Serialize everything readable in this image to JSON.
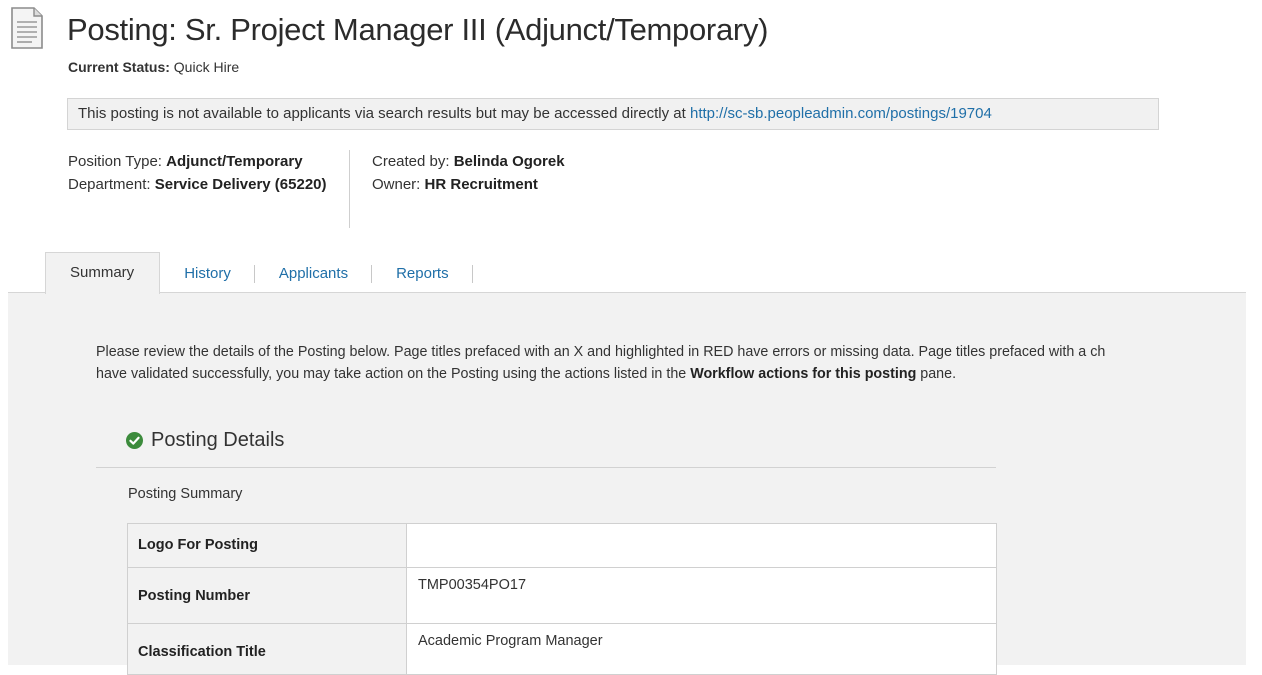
{
  "header": {
    "doc_icon": "document-icon",
    "title": "Posting: Sr. Project Manager III (Adjunct/Temporary)",
    "status_label": "Current Status:",
    "status_value": "Quick Hire"
  },
  "notice": {
    "text": "This posting is not available to applicants via search results but may be accessed directly at ",
    "link": "http://sc-sb.peopleadmin.com/postings/19704"
  },
  "meta": {
    "position_type_label": "Position Type:",
    "position_type_value": "Adjunct/Temporary",
    "department_label": "Department:",
    "department_value": "Service Delivery (65220)",
    "created_by_label": "Created by:",
    "created_by_value": "Belinda Ogorek",
    "owner_label": "Owner:",
    "owner_value": "HR Recruitment"
  },
  "tabs": [
    {
      "label": "Summary",
      "active": true
    },
    {
      "label": "History",
      "active": false
    },
    {
      "label": "Applicants",
      "active": false
    },
    {
      "label": "Reports",
      "active": false
    }
  ],
  "intro": {
    "line1": "Please review the details of the Posting below.  Page titles prefaced with an X and highlighted in RED have errors or missing data.  Page titles prefaced with a ch",
    "line2_before": "have validated successfully, you may take action on the Posting using the actions listed in the ",
    "line2_bold": "Workflow actions for this posting",
    "line2_after": " pane."
  },
  "section": {
    "check_icon": "check-circle-icon",
    "check_color": "#3c8b3c",
    "title": "Posting Details",
    "subtitle": "Posting Summary"
  },
  "summary_rows": [
    {
      "label": "Logo For Posting",
      "value": ""
    },
    {
      "label": "Posting Number",
      "value": "TMP00354PO17"
    },
    {
      "label": "Classification Title",
      "value": "Academic Program Manager"
    }
  ]
}
